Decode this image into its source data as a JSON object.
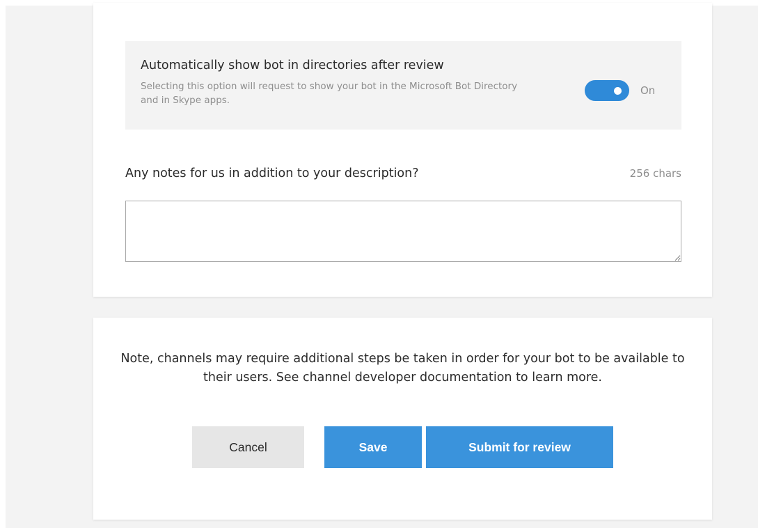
{
  "directory_option": {
    "title": "Automatically show bot in directories after review",
    "description": "Selecting this option will request to show your bot in the Microsoft Bot Directory and in Skype apps.",
    "toggle_on": true,
    "toggle_label": "On"
  },
  "notes": {
    "label": "Any notes for us in addition to your description?",
    "char_count": "256 chars",
    "value": ""
  },
  "footer": {
    "note": "Note, channels may require additional steps be taken in order for your bot to be available to their users. See channel developer documentation to learn more.",
    "cancel_label": "Cancel",
    "save_label": "Save",
    "submit_label": "Submit for review"
  },
  "colors": {
    "accent": "#3a93dc",
    "toggle": "#2f8ad8",
    "panel": "#f3f3f3",
    "muted_text": "#8e8e8e",
    "secondary_button": "#e6e6e6"
  }
}
